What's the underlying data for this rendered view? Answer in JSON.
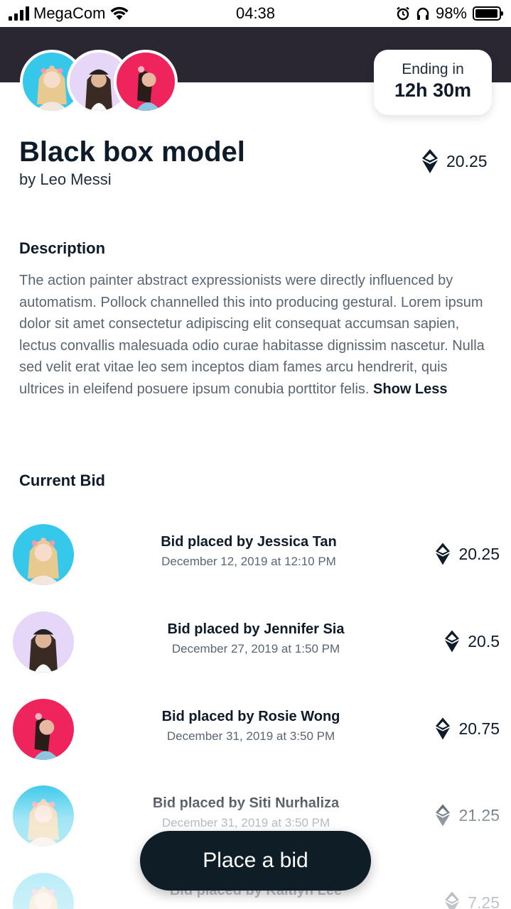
{
  "status_bar": {
    "carrier": "MegaCom",
    "time": "04:38",
    "battery": "98%",
    "battery_level": 0.98
  },
  "item": {
    "title": "Black box model",
    "artist": "by Leo Messi",
    "price": "20.25",
    "ending_label": "Ending in",
    "ending_value": "12h 30m"
  },
  "description": {
    "heading": "Description",
    "text": "The action painter abstract expressionists were directly influenced by automatism. Pollock channelled this into producing gestural. Lorem ipsum dolor sit amet consectetur adipiscing elit consequat accumsan sapien, lectus convallis malesuada odio curae habitasse dignissim nascetur. Nulla sed velit erat vitae leo sem inceptos diam fames arcu hendrerit, quis ultrices in eleifend posuere ipsum conubia porttitor felis.",
    "toggle": "Show Less"
  },
  "bids": {
    "heading": "Current Bid",
    "items": [
      {
        "name": "Bid placed by Jessica Tan",
        "date": "December 12, 2019 at 12:10 PM",
        "amount": "20.25",
        "avatar_bg": "#35c8ea"
      },
      {
        "name": "Bid placed by Jennifer Sia",
        "date": "December 27, 2019 at 1:50 PM",
        "amount": "20.5",
        "avatar_bg": "#e6d6f7"
      },
      {
        "name": "Bid placed by Rosie Wong",
        "date": "December 31, 2019 at 3:50 PM",
        "amount": "20.75",
        "avatar_bg": "#f0245c"
      },
      {
        "name": "Bid placed by Siti Nurhaliza",
        "date": "December 31, 2019 at 3:50 PM",
        "amount": "21.25",
        "avatar_bg": "#35c8ea"
      },
      {
        "name": "Bid placed by Kaitlyn Lee",
        "date": "",
        "amount": "7.25",
        "avatar_bg": "#35c8ea"
      }
    ]
  },
  "cta": {
    "label": "Place a bid"
  },
  "colors": {
    "dark": "#0f1d26",
    "hero": "#2a2632",
    "text": "#0e1b2b",
    "muted": "#5a6673"
  }
}
